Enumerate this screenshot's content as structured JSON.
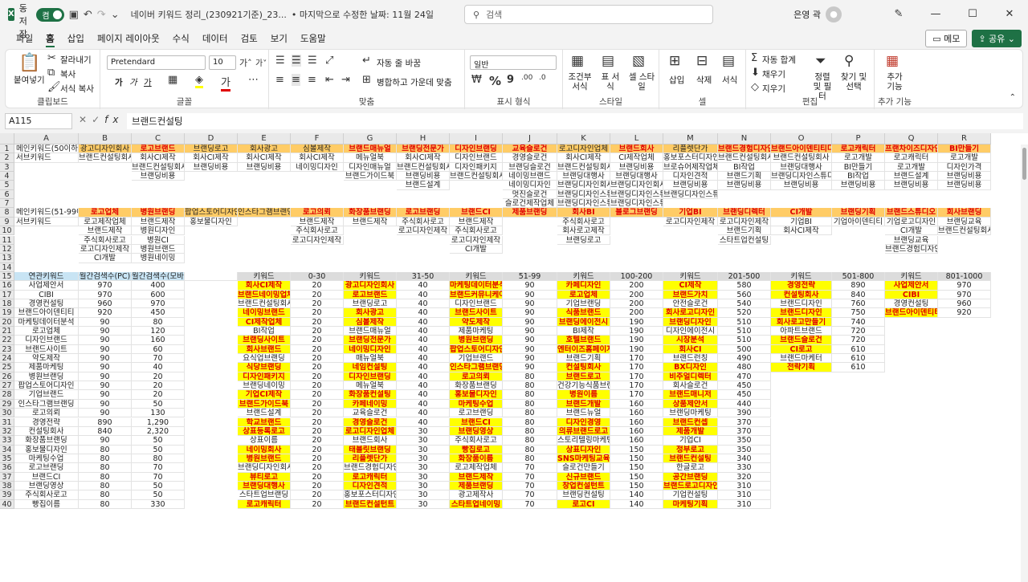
{
  "titlebar": {
    "autosave_label": "자동 저장",
    "autosave_state": "켬",
    "doc_title": "네이버 키워드 정리_(230921기준)_23...",
    "saved_status": "• 마지막으로 수정한 날짜: 11월 24일",
    "search_placeholder": "검색",
    "user_name": "은영 곽"
  },
  "menu": {
    "items": [
      "파일",
      "홈",
      "삽입",
      "페이지 레이아웃",
      "수식",
      "데이터",
      "검토",
      "보기",
      "도움말"
    ],
    "active": "홈",
    "memo": "메모",
    "share": "공유"
  },
  "ribbon": {
    "clipboard": {
      "paste": "붙여넣기",
      "cut": "잘라내기",
      "copy": "복사",
      "format_painter": "서식 복사",
      "label": "클립보드"
    },
    "font": {
      "name": "Pretendard",
      "size": "10",
      "label": "글꼴",
      "bold": "가",
      "italic": "가",
      "underline": "가"
    },
    "align": {
      "wrap": "자동 줄 바꿈",
      "merge": "병합하고 가운데 맞춤",
      "label": "맞춤"
    },
    "number": {
      "format": "일반",
      "label": "표시 형식"
    },
    "styles": {
      "conditional": "조건부 서식",
      "table": "표 서식",
      "cell": "셀 스타일",
      "label": "스타일"
    },
    "cells": {
      "insert": "삽입",
      "delete": "삭제",
      "format": "서식",
      "label": "셀"
    },
    "editing": {
      "autosum": "자동 합계",
      "fill": "채우기",
      "clear": "지우기",
      "sort": "정렬 및 필터",
      "find": "찾기 및 선택",
      "label": "편집"
    },
    "addins": {
      "label": "추가 기능",
      "btn": "추가 기능"
    }
  },
  "formula": {
    "cell_ref": "A115",
    "content": "브랜드컨설팅"
  },
  "columns": [
    "A",
    "B",
    "C",
    "D",
    "E",
    "F",
    "G",
    "H",
    "I",
    "J",
    "K",
    "L",
    "M",
    "N",
    "O",
    "P",
    "Q",
    "R"
  ],
  "rows": {
    "1": [
      "메인키워드(50이하)",
      "광고디자인회사",
      "로고브랜드",
      "브랜딩로고",
      "회사광고",
      "심볼제작",
      "브랜드매뉴얼",
      "브랜딩전문가",
      "디자인브랜딩",
      "교육슬로건",
      "로고디자인업체",
      "브랜드회사",
      "리플렛단가",
      "브랜드경험디자인",
      "브랜드아이덴티티디자인",
      "로고캐릭터",
      "프랜차이즈디자인",
      "BI만들기"
    ],
    "2": [
      "서브키워드",
      "브랜드컨설팅회사",
      "회사CI제작",
      "회사CI제작",
      "회사CI제작",
      "회사CI제작",
      "메뉴얼북",
      "회사CI제작",
      "디자인브랜드",
      "경영슬로건",
      "회사CI제작",
      "CI제작업체",
      "홍보포스터디자인",
      "브랜드컨설팅회사",
      "브랜드컨설팅회사",
      "로고개발",
      "로고캐릭터",
      "로고개발"
    ],
    "3": [
      "",
      "",
      "브랜드컨설팅회사",
      "브랜딩비용",
      "브랜딩비용",
      "네이밍디자인",
      "디자인매뉴얼",
      "브랜드컨설팅회사",
      "디자인패키지",
      "브랜딩슬로건",
      "브랜드컨설팅회사",
      "브랜딩비용",
      "브로슈어제작업체",
      "BI작업",
      "브랜딩대행사",
      "BI만들기",
      "로고개발",
      "디자인가격"
    ],
    "4": [
      "",
      "",
      "브랜딩비용",
      "",
      "",
      "",
      "브랜드가이드북",
      "브랜딩비용",
      "브랜드컨설팅회사",
      "네이밍브랜드",
      "브랜딩대행사",
      "브랜딩대행사",
      "디자인견적",
      "브랜드기획",
      "브랜딩디자인스튜디오",
      "BI작업",
      "브랜드설계",
      "브랜딩비용"
    ],
    "5": [
      "",
      "",
      "",
      "",
      "",
      "",
      "",
      "브랜드설계",
      "",
      "네이밍디자인",
      "브랜딩디자인회사",
      "브랜딩디자인회사",
      "브랜딩비용",
      "브랜딩비용",
      "브랜딩비용",
      "브랜딩비용",
      "브랜딩비용",
      "브랜딩비용"
    ],
    "6": [
      "",
      "",
      "",
      "",
      "",
      "",
      "",
      "",
      "",
      "멋진슬로건",
      "브랜딩디자인스튜디오",
      "브랜딩디자인스튜디오",
      "브랜딩디자인스튜디오",
      "",
      "",
      "",
      "",
      ""
    ],
    "7": [
      "",
      "",
      "",
      "",
      "",
      "",
      "",
      "",
      "",
      "슬로건제작업체",
      "브랜딩디자인스튜디오",
      "브랜딩디자인스튜디오",
      "",
      "",
      "",
      "",
      "",
      ""
    ],
    "8": [
      "메인키워드(51-99이하)",
      "로고업체",
      "병원브랜딩",
      "팝업스토어디자인",
      "인스타그램브랜딩",
      "로고의뢰",
      "화장품브랜딩",
      "로고브랜딩",
      "브랜드CI",
      "제품브랜딩",
      "회사BI",
      "블로그브랜딩",
      "기업BI",
      "브랜딩디렉터",
      "CI개발",
      "브랜딩기획",
      "브랜드스튜디오",
      "회사브랜딩"
    ],
    "9": [
      "서브키워드",
      "로고제작업체",
      "브랜드제작",
      "홍보물디자인",
      "",
      "브랜드제작",
      "브랜드제작",
      "주식회사로고",
      "브랜드제작",
      "",
      "주식회사로고",
      "",
      "로고디자인제작",
      "로고디자인제작",
      "기업BI",
      "기업아이덴티티",
      "기업로고디자인",
      "브랜딩교육"
    ],
    "10": [
      "",
      "브랜드제작",
      "병원디자인",
      "",
      "",
      "주식회사로고",
      "",
      "로고디자인제작",
      "주식회사로고",
      "",
      "회사로고제작",
      "",
      "",
      "브랜드기획",
      "회사CI제작",
      "",
      "CI개발",
      "브랜드컨설팅회사"
    ],
    "11": [
      "",
      "주식회사로고",
      "병원CI",
      "",
      "",
      "로고디자인제작",
      "",
      "",
      "로고디자인제작",
      "",
      "브랜딩로고",
      "",
      "",
      "스타트업컨설팅",
      "",
      "",
      "브랜딩교육",
      ""
    ],
    "12": [
      "",
      "로고디자인제작",
      "병원브랜드",
      "",
      "",
      "",
      "",
      "",
      "CI개발",
      "",
      "",
      "",
      "",
      "",
      "",
      "",
      "브랜드경험디자인",
      ""
    ],
    "13": [
      "",
      "CI개발",
      "병원네이밍",
      "",
      "",
      "",
      "",
      "",
      "",
      "",
      "",
      "",
      "",
      "",
      "",
      "",
      "",
      ""
    ],
    "14": [
      "",
      "",
      "",
      "",
      "",
      "",
      "",
      "",
      "",
      "",
      "",
      "",
      "",
      "",
      "",
      "",
      "",
      ""
    ],
    "15": [
      "연관키워드",
      "월간검색수(PC)",
      "월간검색수(모바일)",
      "",
      "키워드",
      "0-30",
      "키워드",
      "31-50",
      "키워드",
      "51-99",
      "키워드",
      "100-200",
      "키워드",
      "201-500",
      "키워드",
      "501-800",
      "키워드",
      "801-1000"
    ],
    "16": [
      "사업제안서",
      "970",
      "400",
      "",
      "회사CI제작",
      "20",
      "광고디자인회사",
      "40",
      "마케팅데이터분석",
      "90",
      "카페디자인",
      "200",
      "CI제작",
      "580",
      "경영전략",
      "890",
      "사업제안서",
      "970"
    ],
    "17": [
      "CIBI",
      "970",
      "600",
      "",
      "브랜드네이밍업체",
      "20",
      "로고브랜드",
      "40",
      "브랜드커뮤니케이션",
      "90",
      "로고업체",
      "200",
      "브랜드가치",
      "560",
      "컨설팅회사",
      "840",
      "CIBI",
      "970"
    ],
    "18": [
      "경영컨설팅",
      "960",
      "970",
      "",
      "브랜드컨설팅회사",
      "20",
      "브랜딩로고",
      "40",
      "디자인브랜드",
      "90",
      "기업브랜딩",
      "200",
      "안전슬로건",
      "540",
      "브랜드디자인",
      "760",
      "경영컨설팅",
      "960"
    ],
    "19": [
      "브랜드아이덴티티",
      "920",
      "450",
      "",
      "네이밍브랜드",
      "20",
      "회사광고",
      "40",
      "브랜드사이트",
      "90",
      "식품브랜드",
      "200",
      "회사로고디자인",
      "520",
      "브랜드디자인",
      "750",
      "브랜드아이덴티티",
      "920"
    ],
    "20": [
      "마케팅데이터분석",
      "90",
      "80",
      "",
      "CI제작업체",
      "20",
      "심볼제작",
      "40",
      "약도제작",
      "90",
      "브랜딩에이전시",
      "190",
      "브랜딩디자인",
      "510",
      "회사로고만들기",
      "740",
      "",
      ""
    ],
    "21": [
      "로고업체",
      "90",
      "120",
      "",
      "BI작업",
      "20",
      "브랜드매뉴얼",
      "40",
      "제품마케팅",
      "90",
      "BI제작",
      "190",
      "디자인에이전시",
      "510",
      "아파트브랜드",
      "720",
      "",
      ""
    ],
    "22": [
      "디자인브랜드",
      "90",
      "160",
      "",
      "브랜딩사이트",
      "20",
      "브랜딩전문가",
      "40",
      "병원브랜딩",
      "90",
      "호텔브랜드",
      "190",
      "시장분석",
      "510",
      "브랜드슬로건",
      "720",
      "",
      ""
    ],
    "23": [
      "브랜드사이트",
      "90",
      "60",
      "",
      "회사브랜드",
      "20",
      "네이밍디자인",
      "40",
      "팝업스토어디자인",
      "90",
      "엔터이즈홈페이지제작",
      "190",
      "회사CI",
      "500",
      "CI로고",
      "610",
      "",
      ""
    ],
    "24": [
      "약도제작",
      "90",
      "70",
      "",
      "요식업브랜딩",
      "20",
      "매뉴얼북",
      "40",
      "기업브랜드",
      "90",
      "브랜드기획",
      "170",
      "브랜드런칭",
      "490",
      "브랜드마케터",
      "610",
      "",
      ""
    ],
    "25": [
      "제품마케팅",
      "90",
      "40",
      "",
      "식당브랜딩",
      "20",
      "네임컨설팅",
      "40",
      "인스타그램브랜딩",
      "90",
      "컨설팅회사",
      "170",
      "BX디자인",
      "480",
      "전략기획",
      "610",
      "",
      ""
    ],
    "26": [
      "병원브랜딩",
      "90",
      "20",
      "",
      "디자인패키지",
      "20",
      "디자인브랜딩",
      "40",
      "로고의뢰",
      "80",
      "브랜드로고",
      "170",
      "비주얼디렉터",
      "470",
      "",
      "",
      "",
      ""
    ],
    "27": [
      "팝업스토어디자인",
      "90",
      "20",
      "",
      "브랜딩네이밍",
      "20",
      "메뉴얼북",
      "40",
      "화장품브랜딩",
      "80",
      "건강기능식품브랜드",
      "170",
      "회사슬로건",
      "450",
      "",
      "",
      "",
      ""
    ],
    "28": [
      "기업브랜드",
      "90",
      "20",
      "",
      "기업CI제작",
      "20",
      "화장품컨설팅",
      "40",
      "홍보물디자인",
      "80",
      "병원이름",
      "170",
      "브랜드매니저",
      "450",
      "",
      "",
      "",
      ""
    ],
    "29": [
      "인스타그램브랜딩",
      "90",
      "50",
      "",
      "브랜드가이드북",
      "20",
      "카페네이밍",
      "40",
      "마케팅수업",
      "80",
      "브랜드개발",
      "160",
      "상품제안서",
      "440",
      "",
      "",
      "",
      ""
    ],
    "30": [
      "로고의뢰",
      "90",
      "130",
      "",
      "브랜드설계",
      "20",
      "교육슬로건",
      "40",
      "로고브랜딩",
      "80",
      "브랜드뉴얼",
      "160",
      "브랜딩마케팅",
      "390",
      "",
      "",
      "",
      ""
    ],
    "31": [
      "경영전략",
      "890",
      "1,290",
      "",
      "학교브랜드",
      "20",
      "경영슬로건",
      "40",
      "브랜드CI",
      "80",
      "디자인경영",
      "160",
      "브랜드컨셉",
      "370",
      "",
      "",
      "",
      ""
    ],
    "32": [
      "컨설팅회사",
      "840",
      "2,320",
      "",
      "상표등록로고",
      "20",
      "로고디자인업체",
      "30",
      "브랜딩영상",
      "80",
      "의류브랜드로고",
      "160",
      "제품개발",
      "370",
      "",
      "",
      "",
      ""
    ],
    "33": [
      "화장품브랜딩",
      "90",
      "50",
      "",
      "상표이름",
      "20",
      "브랜드회사",
      "30",
      "주식회사로고",
      "80",
      "스토리텔링마케팅",
      "160",
      "기업CI",
      "350",
      "",
      "",
      "",
      ""
    ],
    "34": [
      "홍보물디자인",
      "80",
      "50",
      "",
      "네이밍회사",
      "20",
      "태블릿브랜딩",
      "30",
      "빵집로고",
      "80",
      "상표디자인",
      "150",
      "정부로고",
      "350",
      "",
      "",
      "",
      ""
    ],
    "35": [
      "마케팅수업",
      "80",
      "80",
      "",
      "병원브랜드",
      "20",
      "리플렛단가",
      "30",
      "화장품이름",
      "80",
      "SNS마케팅교육",
      "150",
      "브랜드컨설팅",
      "340",
      "",
      "",
      "",
      ""
    ],
    "36": [
      "로고브랜딩",
      "80",
      "70",
      "",
      "브랜딩디자인회사",
      "20",
      "브랜드경험디자인",
      "30",
      "로고제작업체",
      "70",
      "슬로건만들기",
      "150",
      "한글로고",
      "330",
      "",
      "",
      "",
      ""
    ],
    "37": [
      "브랜드CI",
      "80",
      "70",
      "",
      "뷰티로고",
      "20",
      "로고캐릭터",
      "30",
      "브랜드제작",
      "70",
      "신규브랜드",
      "150",
      "공간브랜딩",
      "320",
      "",
      "",
      "",
      ""
    ],
    "38": [
      "브랜딩영상",
      "80",
      "50",
      "",
      "브랜딩대행사",
      "20",
      "디자인견적",
      "30",
      "제품브랜딩",
      "70",
      "창업컨설턴트",
      "150",
      "브랜드로고디자인",
      "310",
      "",
      "",
      "",
      ""
    ],
    "39": [
      "주식회사로고",
      "80",
      "50",
      "",
      "스타트업브랜딩",
      "20",
      "홍보포스터디자인",
      "30",
      "광고제작사",
      "70",
      "브랜딩컨설팅",
      "140",
      "기업컨설팅",
      "310",
      "",
      "",
      "",
      ""
    ],
    "40": [
      "빵집이름",
      "80",
      "330",
      "",
      "로고캐릭터",
      "20",
      "브랜드컨설턴트",
      "30",
      "스타트업네이밍",
      "70",
      "로고CI",
      "140",
      "마케팅기획",
      "310",
      "",
      "",
      "",
      ""
    ]
  }
}
